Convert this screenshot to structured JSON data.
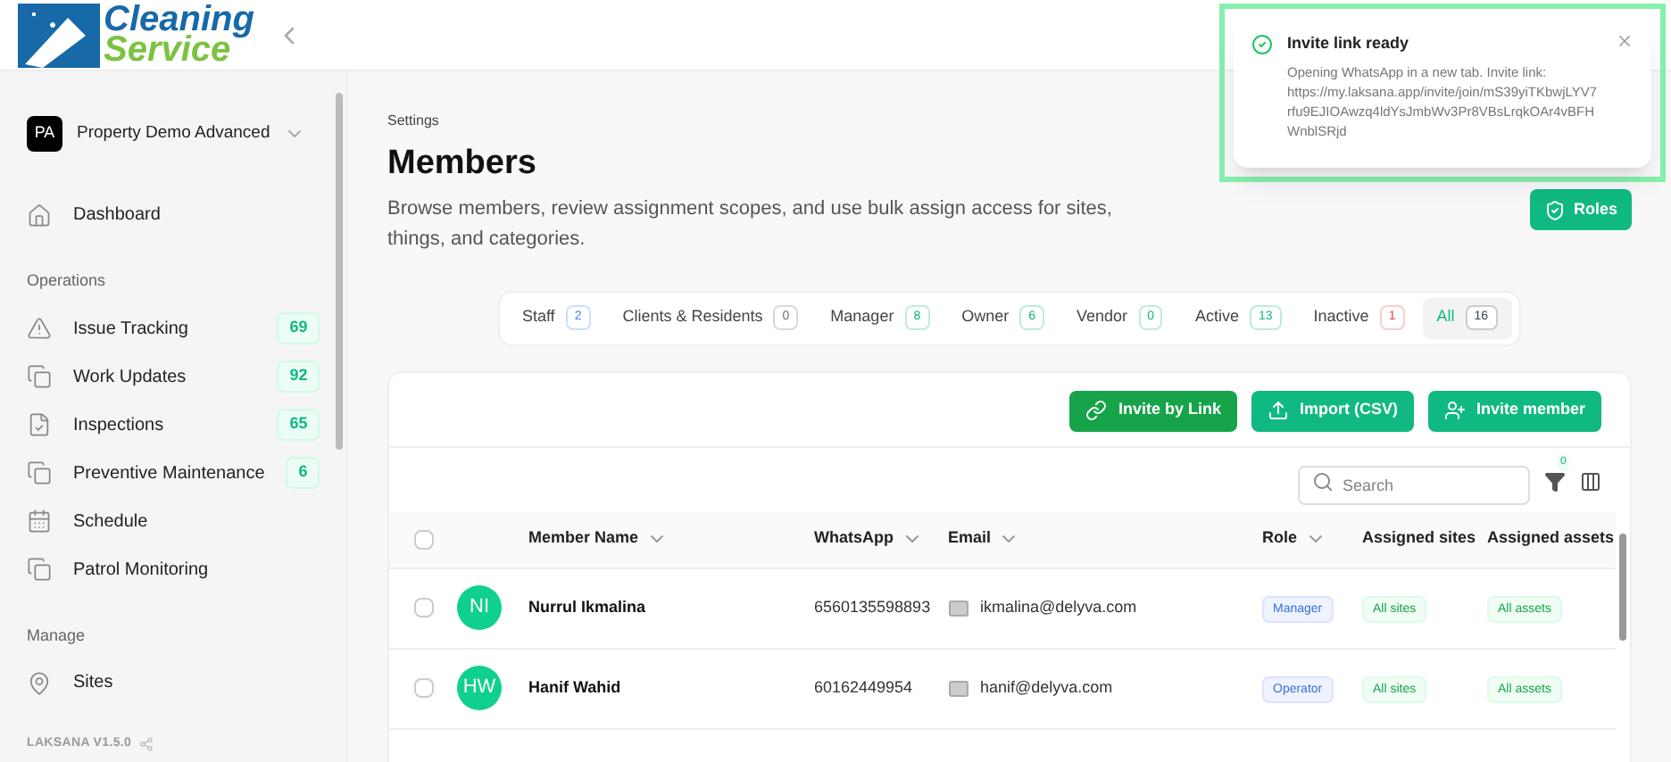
{
  "logo": {
    "line1": "Cleaning",
    "line2": "Service"
  },
  "workspace": {
    "initials": "PA",
    "name": "Property Demo Advanced"
  },
  "sidebar": {
    "items": [
      {
        "kind": "home",
        "label": "Dashboard"
      }
    ],
    "sections": [
      {
        "title": "Operations",
        "items": [
          {
            "kind": "warning",
            "label": "Issue Tracking",
            "badge": "69"
          },
          {
            "kind": "copy",
            "label": "Work Updates",
            "badge": "92"
          },
          {
            "kind": "file",
            "label": "Inspections",
            "badge": "65"
          },
          {
            "kind": "copy",
            "label": "Preventive Maintenance",
            "badge": "6"
          },
          {
            "kind": "calendar",
            "label": "Schedule"
          },
          {
            "kind": "copy",
            "label": "Patrol Monitoring"
          }
        ]
      },
      {
        "title": "Manage",
        "items": [
          {
            "kind": "pin",
            "label": "Sites"
          }
        ]
      }
    ]
  },
  "version": "LAKSANA V1.5.0",
  "breadcrumb": "Settings",
  "title": "Members",
  "description": "Browse members, review assignment scopes, and use bulk assign access for sites, things, and categories.",
  "roles_button": "Roles",
  "tabs": [
    {
      "label": "Staff",
      "count": "2",
      "color": "#3b82f6",
      "selected": false
    },
    {
      "label": "Clients & Residents",
      "count": "0",
      "color": "#6b7280",
      "selected": false
    },
    {
      "label": "Manager",
      "count": "8",
      "color": "#10b981",
      "selected": false
    },
    {
      "label": "Owner",
      "count": "6",
      "color": "#10b981",
      "selected": false
    },
    {
      "label": "Vendor",
      "count": "0",
      "color": "#10b981",
      "selected": false
    },
    {
      "label": "Active",
      "count": "13",
      "color": "#10b981",
      "selected": false
    },
    {
      "label": "Inactive",
      "count": "1",
      "color": "#ef4444",
      "selected": false
    },
    {
      "label": "All",
      "count": "16",
      "color": "#374151",
      "selected": true
    }
  ],
  "actions": [
    "Invite by Link",
    "Import (CSV)",
    "Invite member"
  ],
  "search": {
    "placeholder": "Search"
  },
  "filter_count": "0",
  "table": {
    "columns": [
      "Member Name",
      "WhatsApp",
      "Email",
      "Role",
      "Assigned sites",
      "Assigned assets"
    ],
    "rows": [
      {
        "initials": "NI",
        "name": "Nurrul Ikmalina",
        "whatsapp": "6560135598893",
        "email": "ikmalina@delyva.com",
        "role": "Manager",
        "sites": "All sites",
        "assets": "All assets",
        "checked": false
      },
      {
        "initials": "HW",
        "name": "Hanif Wahid",
        "whatsapp": "60162449954",
        "email": "hanif@delyva.com",
        "role": "Operator",
        "sites": "All sites",
        "assets": "All assets",
        "checked": false
      }
    ],
    "select_all": {
      "checked": false
    }
  },
  "toast": {
    "title": "Invite link ready",
    "message": "Opening WhatsApp in a new tab. Invite link: https://my.laksana.app/invite/join/mS39yiTKbwjLYV7rfu9EJIOAwzq4ldYsJmbWv3Pr8VBsLrqkOAr4vBFHWnblSRjd"
  }
}
